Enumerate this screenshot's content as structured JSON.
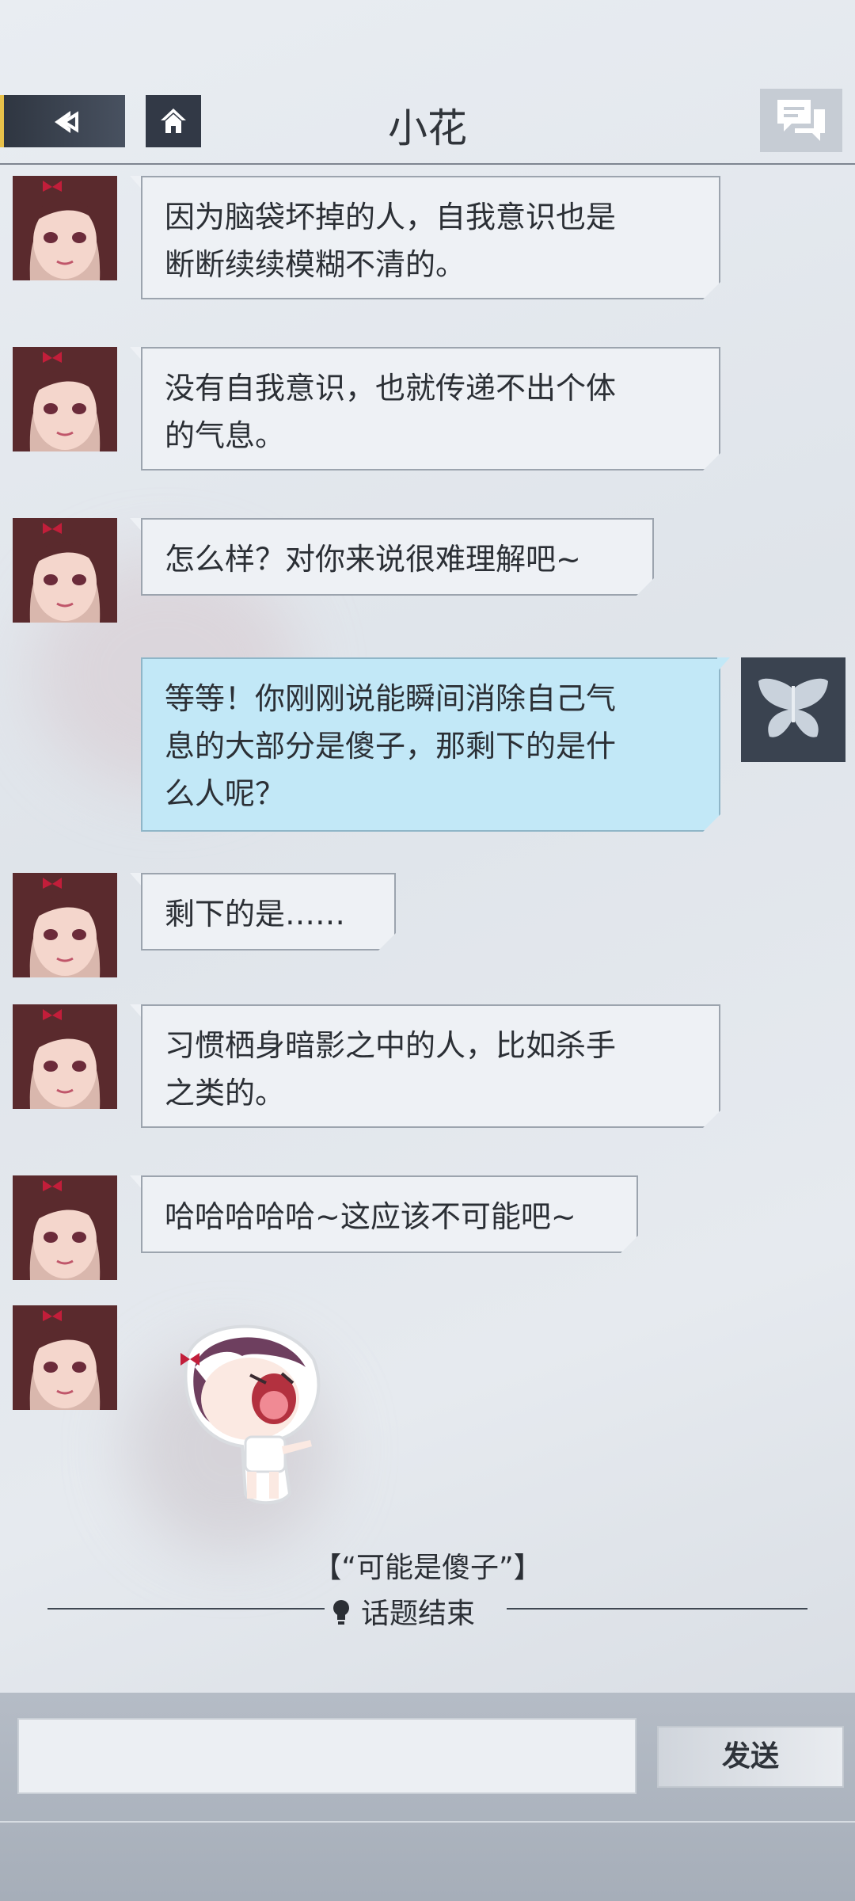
{
  "header": {
    "title": "小花",
    "back_icon": "back-arrow-icon",
    "home_icon": "home-icon",
    "chat_icon": "chat-bubbles-icon"
  },
  "messages": [
    {
      "sender": "小花",
      "side": "left",
      "text_lines": [
        "因为脑袋坏掉的人，自我意识也是",
        "断断续续模糊不清的。"
      ]
    },
    {
      "sender": "小花",
      "side": "left",
      "text_lines": [
        "没有自我意识，也就传递不出个体",
        "的气息。"
      ]
    },
    {
      "sender": "小花",
      "side": "left",
      "text_lines": [
        "怎么样？对你来说很难理解吧~"
      ]
    },
    {
      "sender": "player",
      "side": "right",
      "text_lines": [
        "等等！你刚刚说能瞬间消除自己气",
        "息的大部分是傻子，那剩下的是什",
        "么人呢？"
      ]
    },
    {
      "sender": "小花",
      "side": "left",
      "text_lines": [
        "剩下的是……"
      ]
    },
    {
      "sender": "小花",
      "side": "left",
      "text_lines": [
        "习惯栖身暗影之中的人，比如杀手",
        "之类的。"
      ]
    },
    {
      "sender": "小花",
      "side": "left",
      "text_lines": [
        "哈哈哈哈哈~这应该不可能吧~"
      ]
    },
    {
      "sender": "小花",
      "side": "left",
      "sticker": "shouting-girl-sticker"
    }
  ],
  "topic": {
    "name": "【“可能是傻子”】",
    "end_label": "话题结束",
    "end_icon": "lightbulb-icon"
  },
  "input": {
    "value": "",
    "send_label": "发送"
  },
  "colors": {
    "player_bubble": "#c2e8f7",
    "npc_bubble": "#eef1f5",
    "accent": "#e8c14a"
  }
}
